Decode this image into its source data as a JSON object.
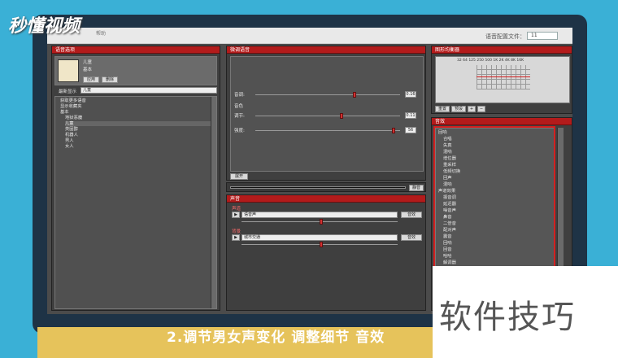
{
  "watermark": {
    "logo": "秒懂视频",
    "corner": "软件技巧"
  },
  "caption": "2.调节男女声变化 调整细节 音效",
  "titlebar": {
    "config_label": "语音配置文件：",
    "config_value": "11",
    "small_text": "帮助"
  },
  "voice_list": {
    "header": "语音选项",
    "profile_name": "儿童",
    "profile_sub": "基本",
    "apply_label": "应用",
    "delete_label": "删除",
    "favorite_label": "最新显示",
    "filter_value": "儿童",
    "items": [
      "获取更多语音",
      "显示收藏夹",
      "基本",
      "地狱恶魔",
      "儿童",
      "类固醇",
      "机器人",
      "男人",
      "女人"
    ]
  },
  "voice_adjust": {
    "header": "微调语音",
    "pitch_label": "音调:",
    "pitch_value": "0.16",
    "timbre_label": "音色",
    "strength_label": "调节:",
    "strength_value": "0.11",
    "breath_label": "强度:",
    "breath_value": "56",
    "expand_label": "展开",
    "mute_label": "静音"
  },
  "sound": {
    "header": "声音",
    "voice_label": "声道",
    "voice_value": "语音声",
    "voice_btn": "音效",
    "bg_label": "背景",
    "bg_value": "城市交通",
    "bg_btn": "音效"
  },
  "equalizer": {
    "header": "图形均衡器",
    "freq_labels": "32 64 125 250 500 1K 2K 4K 8K 16K",
    "reset_label": "重置",
    "preset_label": "预设"
  },
  "effects": {
    "header": "音效",
    "items": [
      "回响",
      "合唱",
      "失真",
      "混响",
      "增位器",
      "重采样",
      "低频切换",
      "回声",
      "混响",
      "声道效果",
      "振音调",
      "延迟器",
      "噪音声",
      "鼻音",
      "二倍音",
      "配对声",
      "震音",
      "回响",
      "回音",
      "哈哈",
      "解调器"
    ]
  }
}
